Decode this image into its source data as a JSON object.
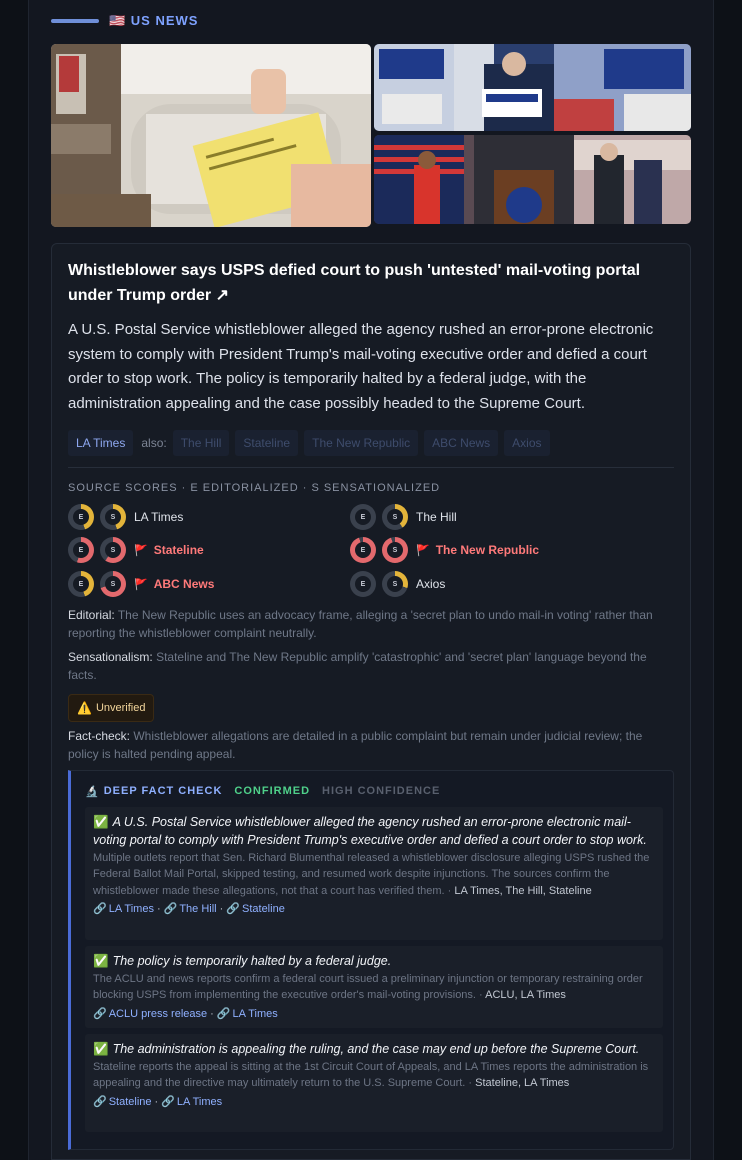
{
  "section": {
    "flag_icon": "us-flag-icon",
    "title": "🇺🇸 US NEWS"
  },
  "images": [
    {
      "alt": "mail-ballot-mailbox-photo"
    },
    {
      "alt": "power-to-the-people-rally-photo"
    },
    {
      "alt": "us-house-press-conference-photo"
    }
  ],
  "article": {
    "headline": "Whistleblower says USPS defied court to push 'untested' mail-voting portal under Trump order ↗",
    "summary": "A U.S. Postal Service whistleblower alleged the agency rushed an error-prone electronic system to comply with President Trump's mail-voting executive order and defied a court order to stop work. The policy is temporarily halted by a federal judge, with the administration appealing and the case possibly headed to the Supreme Court.",
    "primary_source": "LA Times",
    "also_label": "also:",
    "also_sources": [
      "The Hill",
      "Stateline",
      "The New Republic",
      "ABC News",
      "Axios"
    ]
  },
  "scores": {
    "title": "SOURCE SCORES · E EDITORIALIZED · S SENSATIONALIZED",
    "e_letter": "E",
    "s_letter": "S",
    "flag_icon": "🚩",
    "items": [
      {
        "name": "LA Times",
        "e": 0.45,
        "s": 0.45,
        "flagged": false
      },
      {
        "name": "The Hill",
        "e": 0.0,
        "s": 0.4,
        "flagged": false
      },
      {
        "name": "Stateline",
        "e": 0.55,
        "s": 0.6,
        "flagged": true
      },
      {
        "name": "The New Republic",
        "e": 0.95,
        "s": 0.95,
        "flagged": true
      },
      {
        "name": "ABC News",
        "e": 0.45,
        "s": 0.7,
        "flagged": true
      },
      {
        "name": "Axios",
        "e": 0.0,
        "s": 0.3,
        "flagged": false
      }
    ],
    "colors": {
      "low": "#e3b43a",
      "high": "#e3696d",
      "track": "#3a414d"
    }
  },
  "notes": {
    "editorial_label": "Editorial:",
    "editorial_text": "The New Republic uses an advocacy frame, alleging a 'secret plan to undo mail-in voting' rather than reporting the whistleblower complaint neutrally.",
    "sensational_label": "Sensationalism:",
    "sensational_text": "Stateline and The New Republic amplify 'catastrophic' and 'secret plan' language beyond the facts.",
    "badge_icon": "⚠️",
    "badge_label": "Unverified",
    "factcheck_label": "Fact-check:",
    "factcheck_text": "Whistleblower allegations are detailed in a public complaint but remain under judicial review; the policy is halted pending appeal."
  },
  "deep_fact_check": {
    "icon": "🔬",
    "title": "DEEP FACT CHECK",
    "verdict": "CONFIRMED",
    "confidence": "HIGH CONFIDENCE",
    "check_icon": "✅",
    "link_icon": "🔗",
    "claims": [
      {
        "claim": "A U.S. Postal Service whistleblower alleged the agency rushed an error-prone electronic mail-voting portal to comply with President Trump's executive order and defied a court order to stop work.",
        "detail": "Multiple outlets report that Sen. Richard Blumenthal released a whistleblower disclosure alleging USPS rushed the Federal Ballot Mail Portal, skipped testing, and resumed work despite injunctions. The sources confirm the whistleblower made these allegations, not that a court has verified them.",
        "sources": "LA Times, The Hill, Stateline",
        "links": [
          "LA Times",
          "The Hill",
          "Stateline"
        ]
      },
      {
        "claim": "The policy is temporarily halted by a federal judge.",
        "detail": "The ACLU and news reports confirm a federal court issued a preliminary injunction or temporary restraining order blocking USPS from implementing the executive order's mail-voting provisions.",
        "sources": "ACLU, LA Times",
        "links": [
          "ACLU press release",
          "LA Times"
        ]
      },
      {
        "claim": "The administration is appealing the ruling, and the case may end up before the Supreme Court.",
        "detail": "Stateline reports the appeal is sitting at the 1st Circuit Court of Appeals, and LA Times reports the administration is appealing and the directive may ultimately return to the U.S. Supreme Court.",
        "sources": "Stateline, LA Times",
        "links": [
          "Stateline",
          "LA Times"
        ]
      }
    ]
  }
}
